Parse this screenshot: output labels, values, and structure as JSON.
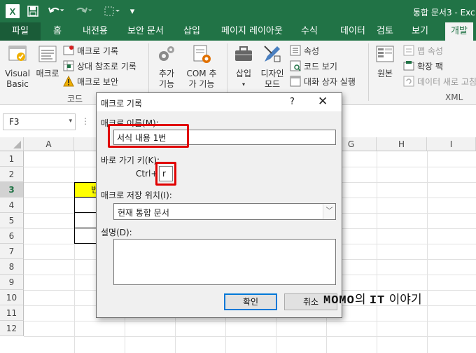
{
  "titlebar": {
    "logo": "X",
    "doc_title": "통합 문서3 - Exc"
  },
  "tabs": [
    {
      "label": "파일"
    },
    {
      "label": "홈"
    },
    {
      "label": "내전용"
    },
    {
      "label": "보안 문서"
    },
    {
      "label": "삽입"
    },
    {
      "label": "페이지 레이아웃"
    },
    {
      "label": "수식"
    },
    {
      "label": "데이터"
    },
    {
      "label": "검토"
    },
    {
      "label": "보기"
    },
    {
      "label": "개발"
    }
  ],
  "ribbon": {
    "code": {
      "visual_basic": "Visual Basic",
      "macro": "매크로",
      "record_macro": "매크로 기록",
      "relative_ref": "상대 참조로 기록",
      "macro_security": "매크로 보안",
      "label": "코드"
    },
    "addins": {
      "addin": "추가 기능",
      "com_addin": "COM 추가 기능"
    },
    "controls": {
      "insert": "삽입",
      "design_mode": "디자인 모드",
      "properties": "속성",
      "view_code": "코드 보기",
      "run_dialog": "대화 상자 실행"
    },
    "xml": {
      "source": "원본",
      "map_properties": "맵 속성",
      "expansion_packs": "확장 팩",
      "refresh_data": "데이터 새로 고침",
      "label": "XML"
    }
  },
  "formula_bar": {
    "namebox": "F3"
  },
  "grid": {
    "columns": [
      "A",
      "B",
      "C",
      "D",
      "E",
      "F",
      "G",
      "H",
      "I"
    ],
    "rows": [
      "1",
      "2",
      "3",
      "4",
      "5",
      "6",
      "7",
      "8",
      "9",
      "10",
      "11",
      "12"
    ],
    "cell_b3": "번"
  },
  "dialog": {
    "title": "매크로 기록",
    "help": "?",
    "close": "✕",
    "name_label": "매크로 이름(M):",
    "name_value": "서식 내용 1번",
    "shortcut_label": "바로 가기 키(K):",
    "ctrl_label": "Ctrl+",
    "shortcut_value": "r",
    "storage_label": "매크로 저장 위치(I):",
    "storage_value": "현재 통합 문서",
    "description_label": "설명(D):",
    "ok": "확인",
    "cancel": "취소"
  },
  "watermark": {
    "brand": "MOMO",
    "particle": "의",
    "it": "IT",
    "story": "이야기"
  },
  "colors": {
    "excel_green": "#217346",
    "highlight_red": "#e00000",
    "cell_yellow": "#ffff00"
  }
}
